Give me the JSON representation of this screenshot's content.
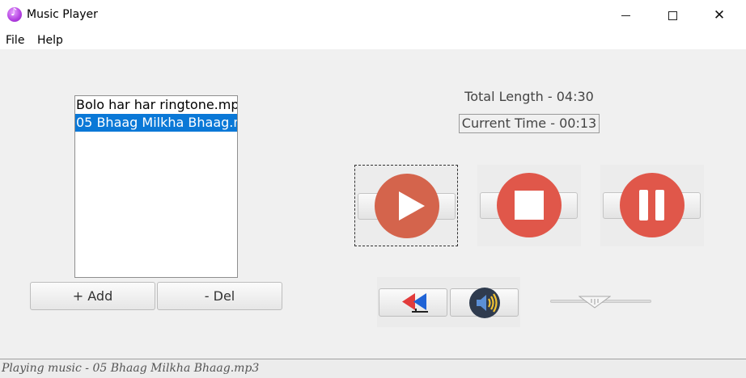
{
  "window": {
    "title": "Music Player",
    "app_icon": "music-note-icon"
  },
  "menu": {
    "file": "File",
    "help": "Help"
  },
  "playlist": {
    "items": [
      {
        "label": "Bolo har har ringtone.mp"
      },
      {
        "label": "05 Bhaag Milkha Bhaag.m",
        "selected": true
      }
    ]
  },
  "buttons": {
    "add": "+ Add",
    "del": "- Del"
  },
  "info": {
    "total_length": "Total Length - 04:30",
    "current_time": "Current Time - 00:13"
  },
  "controls": {
    "play": "play-icon",
    "stop": "stop-icon",
    "pause": "pause-icon",
    "rewind": "rewind-icon",
    "volume": "speaker-icon",
    "accent_color": "#e0574a",
    "play_color": "#d4644c"
  },
  "status": {
    "text": "Playing music - 05 Bhaag Milkha Bhaag.mp3"
  }
}
